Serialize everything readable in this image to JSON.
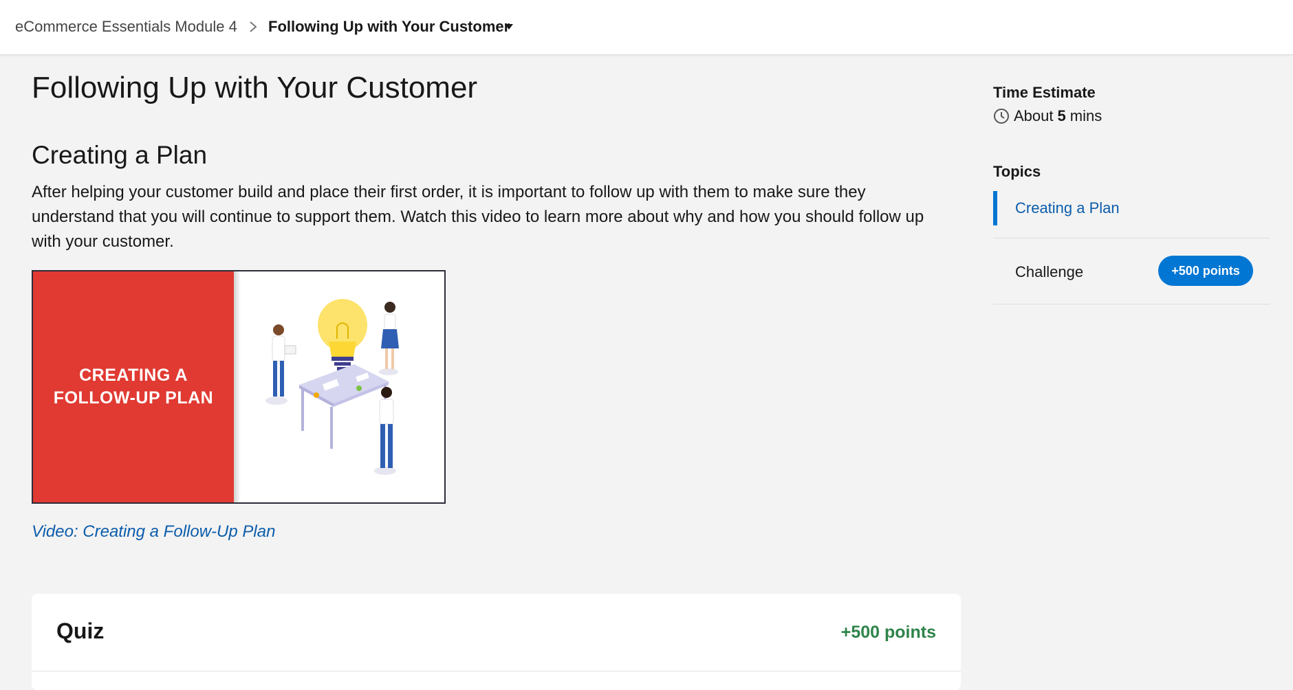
{
  "breadcrumb": {
    "parent": "eCommerce Essentials Module 4",
    "current": "Following Up with Your Customer"
  },
  "main": {
    "title": "Following Up with Your Customer",
    "section_title": "Creating a Plan",
    "body": "After helping your customer build and place their first order, it is important to follow up with them to make sure they understand that you will continue to support them.  Watch this video to learn more about why and how you should follow up with your customer.",
    "video": {
      "thumbnail_text": "CREATING A\nFOLLOW-UP PLAN",
      "caption": "Video: Creating a Follow-Up Plan"
    }
  },
  "quiz": {
    "title": "Quiz",
    "points": "+500 points"
  },
  "sidebar": {
    "time_estimate_label": "Time Estimate",
    "time_prefix": "About",
    "time_value": "5",
    "time_unit": "mins",
    "topics_label": "Topics",
    "topics": [
      {
        "label": "Creating a Plan",
        "active": true
      },
      {
        "label": "Challenge",
        "badge": "+500 points"
      }
    ]
  },
  "icons": {
    "breadcrumb_separator": "chevron-right-icon",
    "breadcrumb_menu": "caret-down-icon",
    "time": "clock-icon"
  },
  "colors": {
    "link": "#0b5cab",
    "accent": "#0176d3",
    "points_green": "#2e844a",
    "thumbnail_red": "#e03a32"
  }
}
